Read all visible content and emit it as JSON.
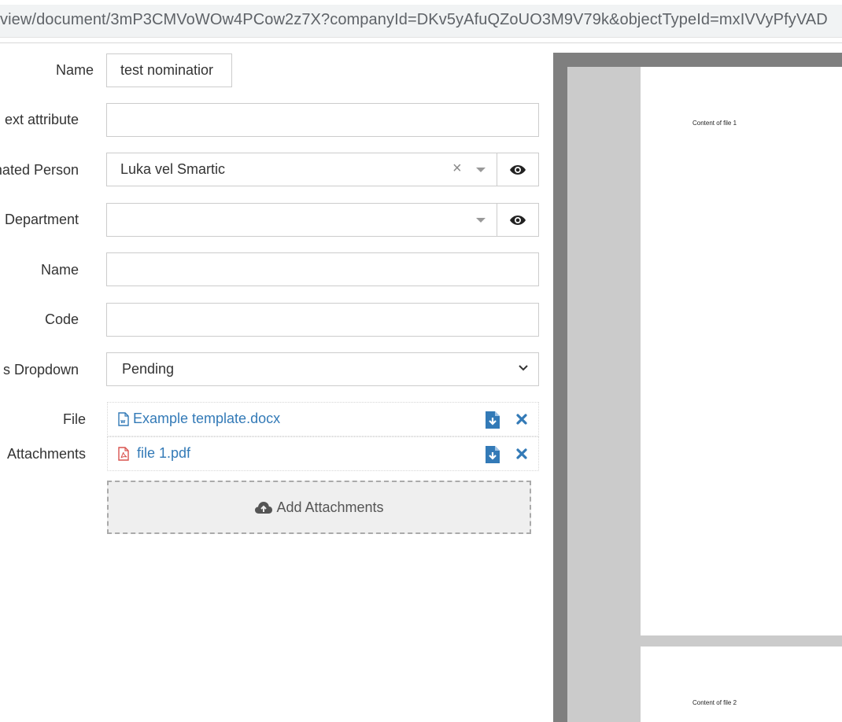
{
  "browser": {
    "url": "view/document/3mP3CMVoWOw4PCow2z7X?companyId=DKv5yAfuQZoUO3M9V79k&objectTypeId=mxIVVyPfyVAD"
  },
  "form": {
    "name_label": "Name",
    "name_value": "test nominatior",
    "text_attribute_label": "ext attribute",
    "text_attribute_value": "",
    "person_label": "nated Person",
    "person_value": "Luka vel Smartic",
    "department_label": "Department",
    "department_value": "",
    "name2_label": "Name",
    "name2_value": "",
    "code_label": "Code",
    "code_value": "",
    "status_label": "s Dropdown",
    "status_value": "Pending",
    "file_label": "File",
    "file_name": "Example template.docx",
    "attachments_label": "Attachments",
    "attachment_name": "file 1.pdf",
    "add_attachments_label": "Add Attachments"
  },
  "viewer": {
    "page1_text": "Content of file 1",
    "page2_text": "Content of file 2"
  },
  "icons": {
    "eye": "eye-icon",
    "clear": "clear-icon",
    "caret": "caret-down-icon",
    "chevron": "chevron-down-icon",
    "word": "word-file-icon",
    "pdf": "pdf-file-icon",
    "download": "download-icon",
    "remove": "remove-icon",
    "upload": "cloud-upload-icon"
  },
  "colors": {
    "link": "#337ab7",
    "pdf_red": "#d9534f",
    "viewer_bg": "#7f7f7f"
  }
}
